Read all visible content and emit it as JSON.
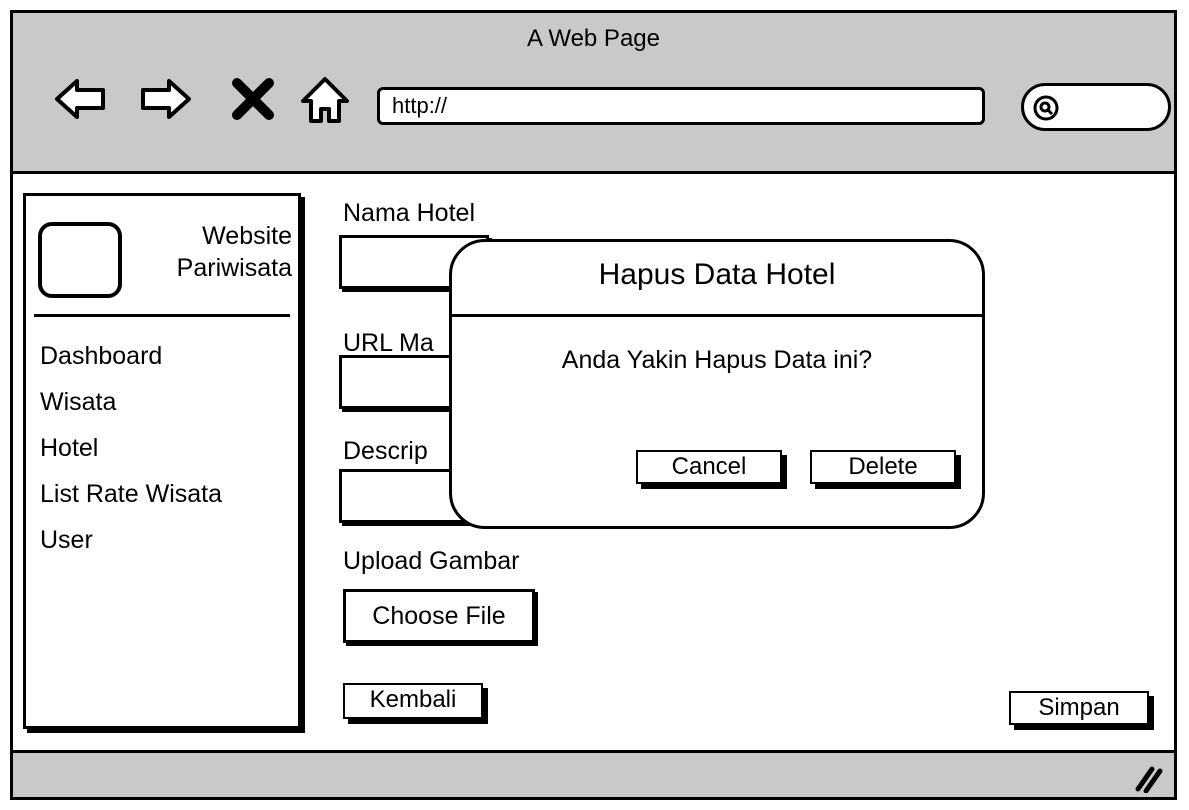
{
  "window": {
    "title": "A Web Page"
  },
  "nav": {
    "back": "back-arrow-icon",
    "forward": "forward-arrow-icon",
    "stop": "close-icon",
    "home": "home-icon"
  },
  "address_bar": {
    "value": "http://"
  },
  "search": {
    "icon": "search-icon"
  },
  "sidebar": {
    "logo_text_line1": "Website",
    "logo_text_line2": "Pariwisata",
    "items": [
      {
        "label": "Dashboard"
      },
      {
        "label": "Wisata"
      },
      {
        "label": "Hotel"
      },
      {
        "label": "List Rate Wisata"
      },
      {
        "label": "User"
      }
    ]
  },
  "form": {
    "nama_label": "Nama Hotel",
    "url_label": "URL Ma",
    "desc_label": "Descrip",
    "upload_label": "Upload Gambar",
    "choose_file": "Choose File",
    "back_button": "Kembali",
    "save_button": "Simpan"
  },
  "dialog": {
    "title": "Hapus Data Hotel",
    "message": "Anda Yakin Hapus Data ini?",
    "cancel": "Cancel",
    "delete": "Delete"
  }
}
